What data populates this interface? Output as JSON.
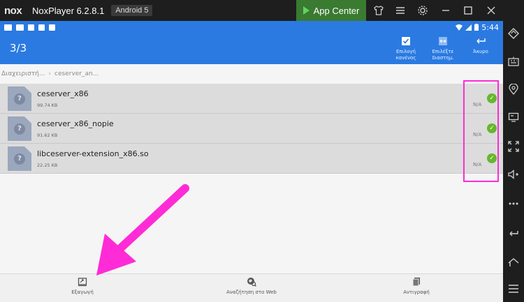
{
  "window": {
    "app_title": "NoxPlayer 6.2.8.1",
    "logo_text": "nox",
    "android_badge": "Android 5",
    "app_center_label": "App Center"
  },
  "status_bar": {
    "time": "5:44"
  },
  "action_bar": {
    "selection_counter": "3/3",
    "select_all_label": "Επιλογή κανένος",
    "select_range_label": "Επιλέξτε διαστημ.",
    "cancel_label": "Άκυρο"
  },
  "breadcrumb": {
    "root": "Διαχειριστή...",
    "current": "ceserver_an..."
  },
  "files": [
    {
      "name": "ceserver_x86",
      "size": "99.74 KB",
      "meta": "N/A"
    },
    {
      "name": "ceserver_x86_nopie",
      "size": "91.62 KB",
      "meta": "N/A"
    },
    {
      "name": "libceserver-extension_x86.so",
      "size": "22.25 KB",
      "meta": "N/A"
    }
  ],
  "bottom_bar": {
    "export_label": "Εξαγωγή",
    "web_search_label": "Αναζήτηση στο Web",
    "copy_label": "Αντιγραφή"
  },
  "colors": {
    "android_blue": "#2a7ae2",
    "annotation_magenta": "#ff2bd6",
    "check_green": "#66b72c",
    "app_center_green": "#3a7a31"
  }
}
